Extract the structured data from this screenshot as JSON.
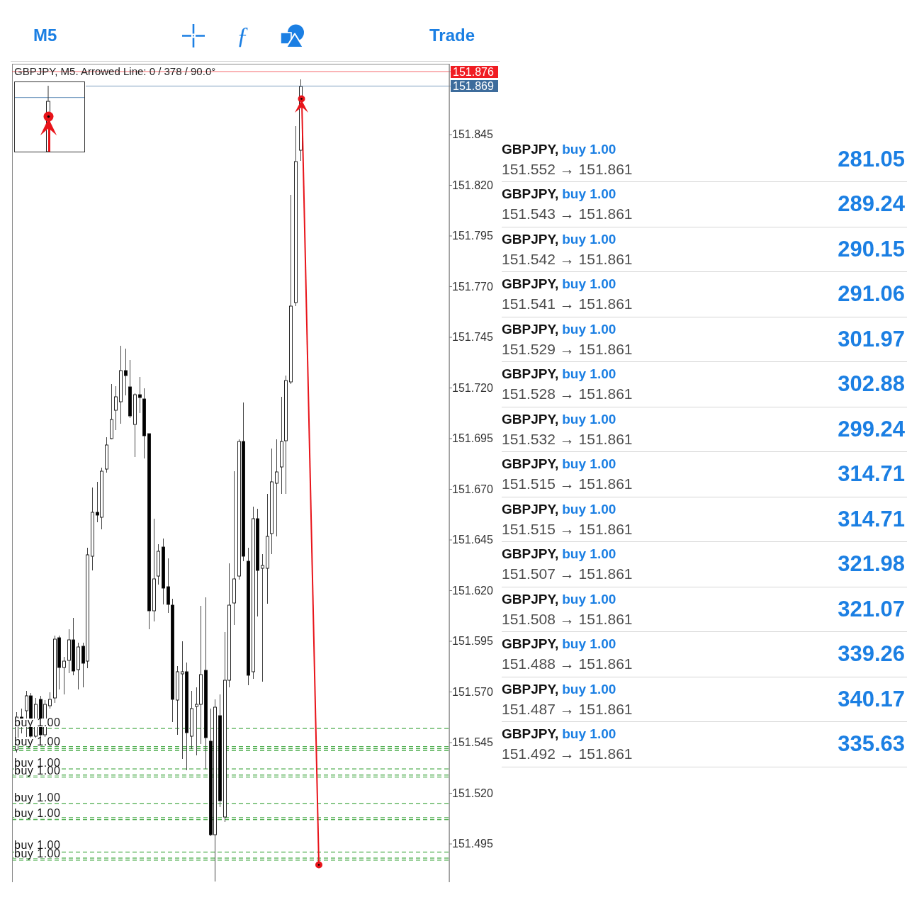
{
  "toolbar": {
    "timeframe": "M5",
    "function_glyph": "ƒ",
    "trade": "Trade"
  },
  "chart": {
    "title": "GBPJPY, M5. Arrowed Line: 0 / 378 / 90.0°",
    "price_tags": [
      {
        "label": "151.876",
        "color": "#f01c22"
      },
      {
        "label": "151.869",
        "color": "#3d6c9c"
      }
    ],
    "axis_labels": [
      "151.845",
      "151.820",
      "151.795",
      "151.770",
      "151.745",
      "151.720",
      "151.695",
      "151.670",
      "151.645",
      "151.620",
      "151.595",
      "151.570",
      "151.545",
      "151.520",
      "151.495"
    ],
    "order_labels": [
      "buy 1.00",
      "buy 1.00",
      "buy 1.00",
      "buy 1.00",
      "buy 1.00",
      "buy 1.00",
      "buy 1.00",
      "buy 1.00"
    ]
  },
  "trades": [
    {
      "symbol": "GBPJPY,",
      "order": "buy 1.00",
      "prices": "151.552 → 151.861",
      "profit": "281.05"
    },
    {
      "symbol": "GBPJPY,",
      "order": "buy 1.00",
      "prices": "151.543 → 151.861",
      "profit": "289.24"
    },
    {
      "symbol": "GBPJPY,",
      "order": "buy 1.00",
      "prices": "151.542 → 151.861",
      "profit": "290.15"
    },
    {
      "symbol": "GBPJPY,",
      "order": "buy 1.00",
      "prices": "151.541 → 151.861",
      "profit": "291.06"
    },
    {
      "symbol": "GBPJPY,",
      "order": "buy 1.00",
      "prices": "151.529 → 151.861",
      "profit": "301.97"
    },
    {
      "symbol": "GBPJPY,",
      "order": "buy 1.00",
      "prices": "151.528 → 151.861",
      "profit": "302.88"
    },
    {
      "symbol": "GBPJPY,",
      "order": "buy 1.00",
      "prices": "151.532 → 151.861",
      "profit": "299.24"
    },
    {
      "symbol": "GBPJPY,",
      "order": "buy 1.00",
      "prices": "151.515 → 151.861",
      "profit": "314.71"
    },
    {
      "symbol": "GBPJPY,",
      "order": "buy 1.00",
      "prices": "151.515 → 151.861",
      "profit": "314.71"
    },
    {
      "symbol": "GBPJPY,",
      "order": "buy 1.00",
      "prices": "151.507 → 151.861",
      "profit": "321.98"
    },
    {
      "symbol": "GBPJPY,",
      "order": "buy 1.00",
      "prices": "151.508 → 151.861",
      "profit": "321.07"
    },
    {
      "symbol": "GBPJPY,",
      "order": "buy 1.00",
      "prices": "151.488 → 151.861",
      "profit": "339.26"
    },
    {
      "symbol": "GBPJPY,",
      "order": "buy 1.00",
      "prices": "151.487 → 151.861",
      "profit": "340.17"
    },
    {
      "symbol": "GBPJPY,",
      "order": "buy 1.00",
      "prices": "151.492 → 151.861",
      "profit": "335.63"
    }
  ]
}
